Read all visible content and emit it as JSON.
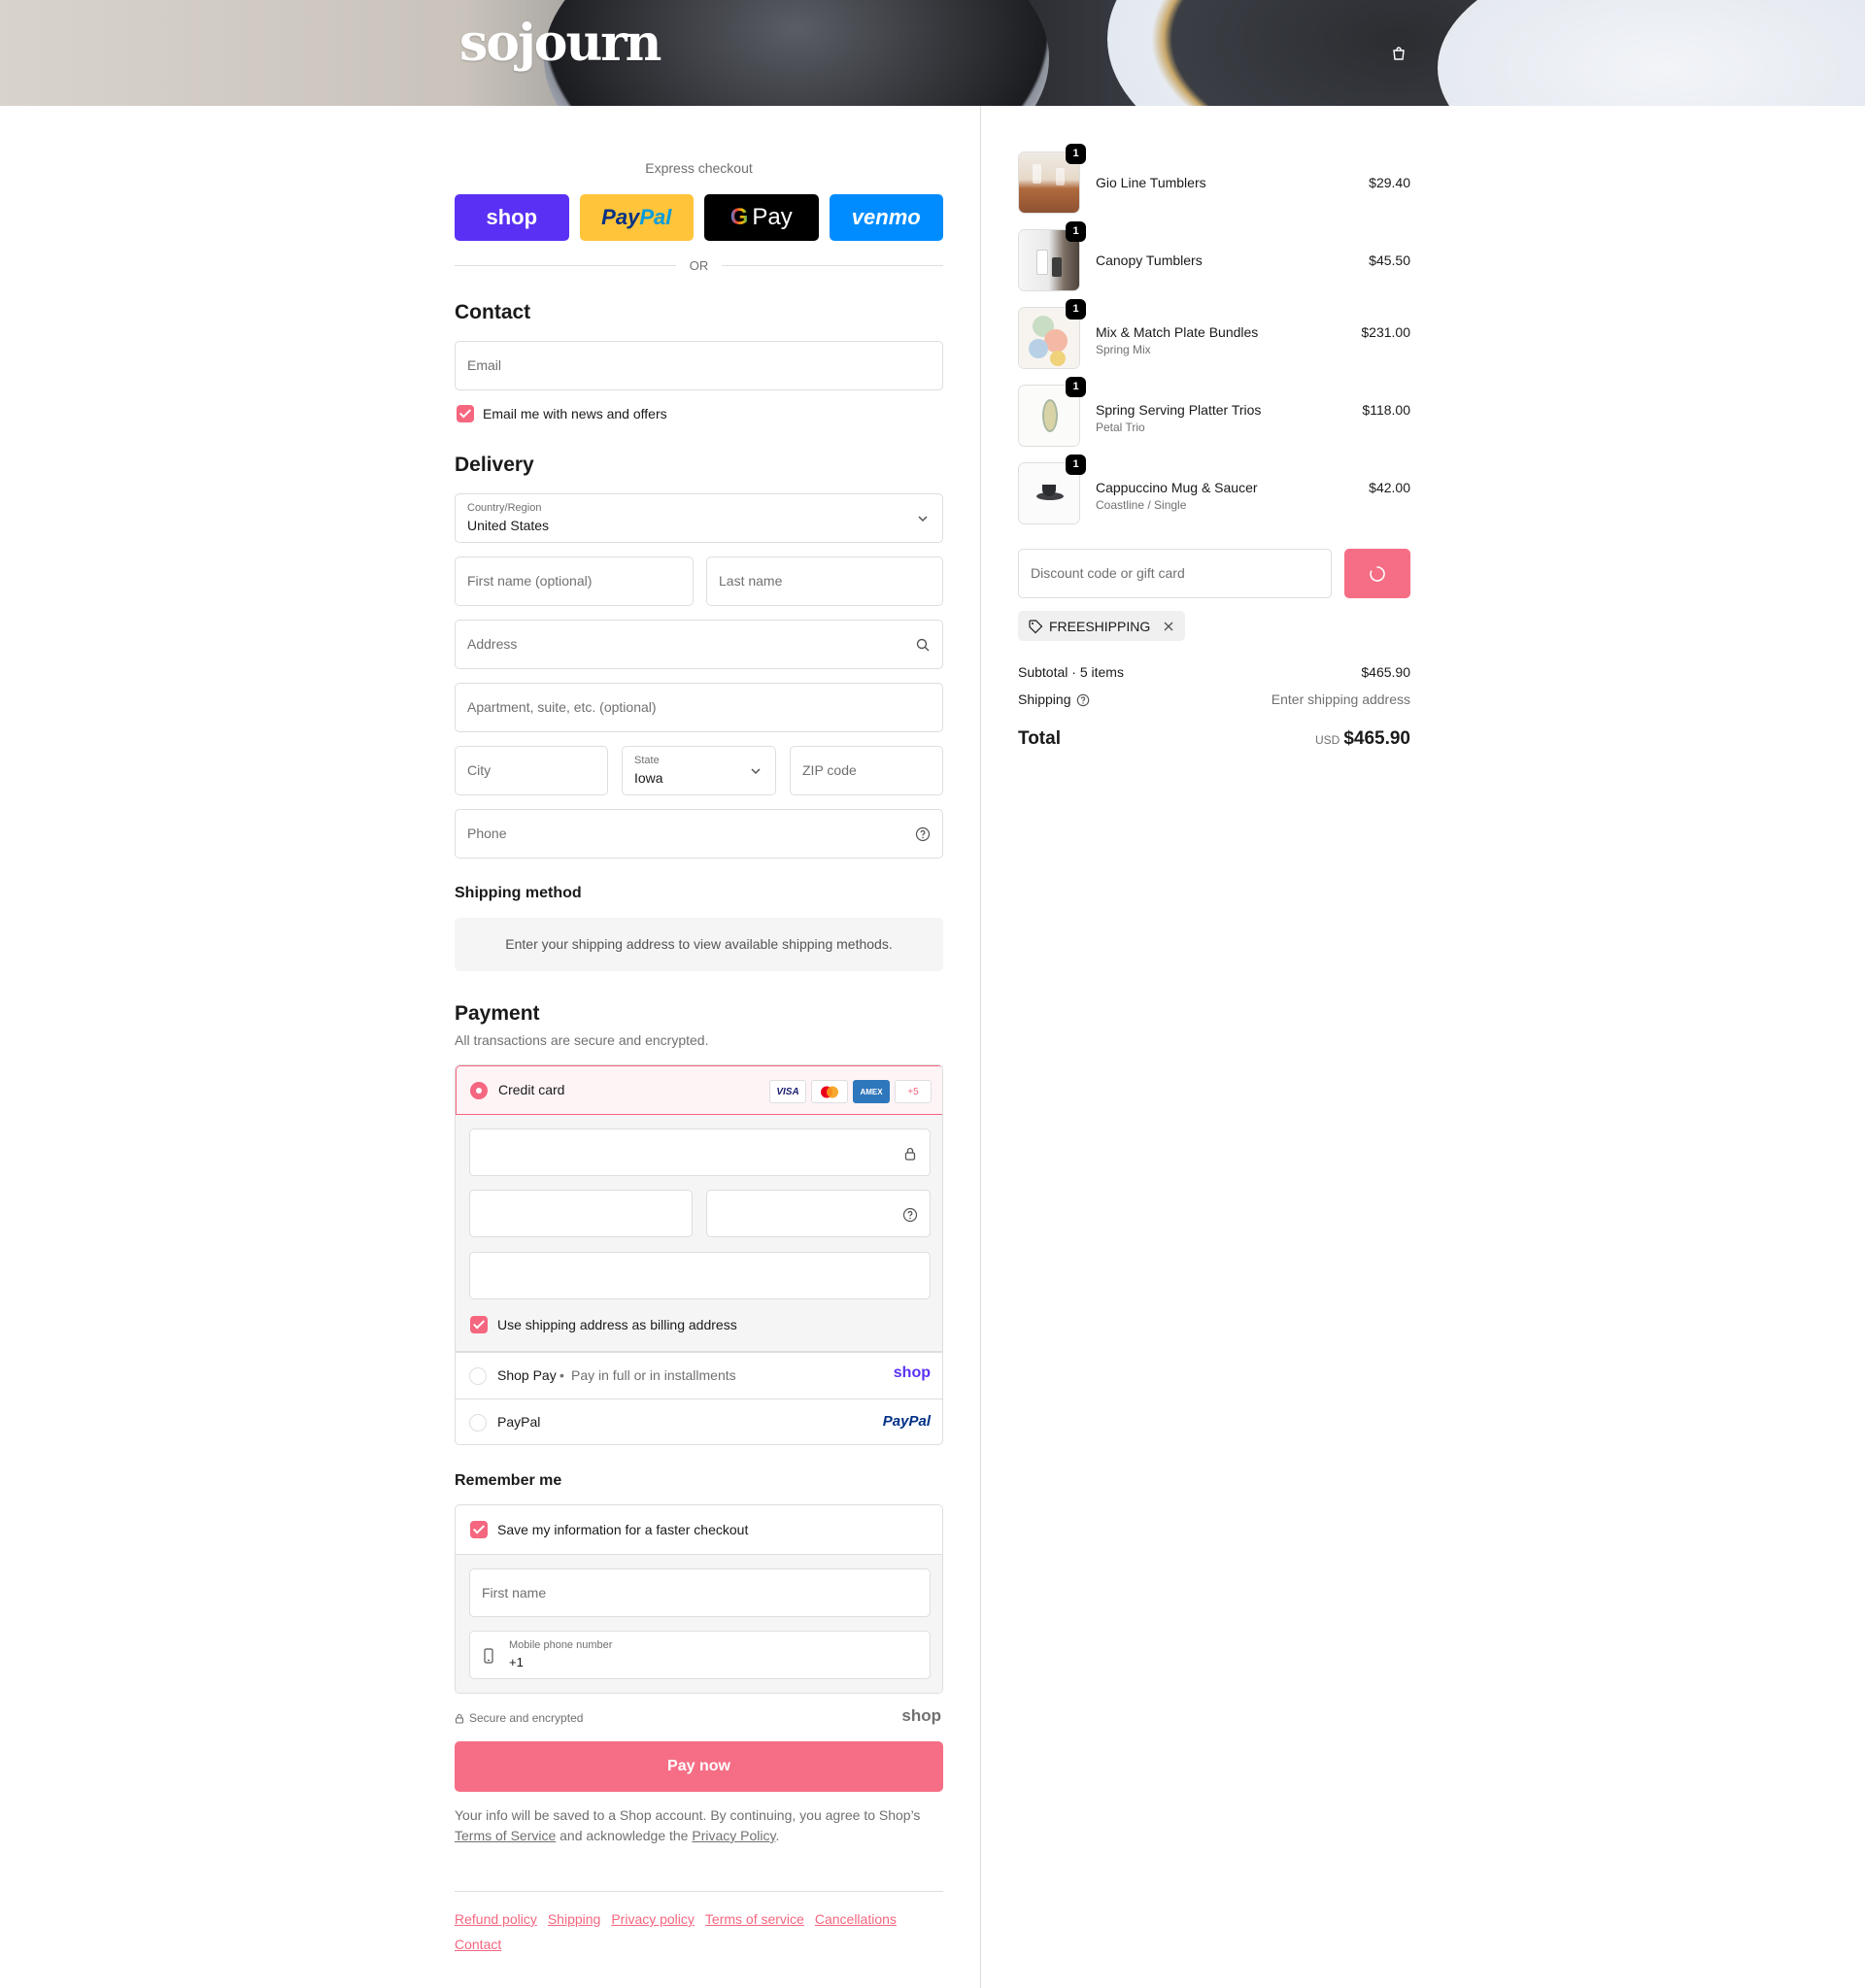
{
  "header": {
    "logo": "sojourn"
  },
  "express": {
    "title": "Express checkout",
    "shop_label": "shop",
    "paypal_a": "Pay",
    "paypal_b": "Pal",
    "gpay_g": "G",
    "gpay_label": "Pay",
    "venmo_label": "venmo",
    "or_label": "OR"
  },
  "contact": {
    "heading": "Contact",
    "email_placeholder": "Email",
    "news_label": "Email me with news and offers"
  },
  "delivery": {
    "heading": "Delivery",
    "country_label": "Country/Region",
    "country_value": "United States",
    "first_name": "First name (optional)",
    "last_name": "Last name",
    "address": "Address",
    "apartment": "Apartment, suite, etc. (optional)",
    "city": "City",
    "state_label": "State",
    "state_value": "Iowa",
    "zip": "ZIP code",
    "phone": "Phone"
  },
  "shipping_method": {
    "heading": "Shipping method",
    "note": "Enter your shipping address to view available shipping methods."
  },
  "payment": {
    "heading": "Payment",
    "subtitle": "All transactions are secure and encrypted.",
    "credit_card": "Credit card",
    "cards": [
      "VISA",
      "MC",
      "AMEX",
      "+5"
    ],
    "billing_same": "Use shipping address as billing address",
    "shop_pay": "Shop Pay",
    "shop_pay_sub": "Pay in full or in installments",
    "shop_logo": "shop",
    "paypal": "PayPal",
    "paypal_logo": "PayPal"
  },
  "remember": {
    "heading": "Remember me",
    "save_label": "Save my information for a faster checkout",
    "first_name": "First name",
    "mobile_label": "Mobile phone number",
    "mobile_value": "+1",
    "secure": "Secure and encrypted",
    "shop_logo": "shop"
  },
  "pay_now": "Pay now",
  "legal": {
    "text1": "Your info will be saved to a Shop account. By continuing, you agree to Shop’s ",
    "tos": "Terms of Service",
    "text2": " and acknowledge the ",
    "privacy": "Privacy Policy",
    "text3": "."
  },
  "footer_links": [
    "Refund policy",
    "Shipping",
    "Privacy policy",
    "Terms of service",
    "Cancellations",
    "Contact"
  ],
  "items": [
    {
      "name": "Gio Line Tumblers",
      "variant": "",
      "price": "$29.40",
      "qty": "1"
    },
    {
      "name": "Canopy Tumblers",
      "variant": "",
      "price": "$45.50",
      "qty": "1"
    },
    {
      "name": "Mix & Match Plate Bundles",
      "variant": "Spring Mix",
      "price": "$231.00",
      "qty": "1"
    },
    {
      "name": "Spring Serving Platter Trios",
      "variant": "Petal Trio",
      "price": "$118.00",
      "qty": "1"
    },
    {
      "name": "Cappuccino Mug & Saucer",
      "variant": "Coastline / Single",
      "price": "$42.00",
      "qty": "1"
    }
  ],
  "summary": {
    "discount_placeholder": "Discount code or gift card",
    "applied_code": "FREESHIPPING",
    "subtotal_label": "Subtotal · 5 items",
    "subtotal_value": "$465.90",
    "shipping_label": "Shipping",
    "shipping_value": "Enter shipping address",
    "total_label": "Total",
    "currency": "USD",
    "total_value": "$465.90"
  },
  "colors": {
    "accent": "#f5667f",
    "shop_purple": "#5a31f4",
    "paypal_yellow": "#ffc439",
    "venmo_blue": "#008cff"
  }
}
